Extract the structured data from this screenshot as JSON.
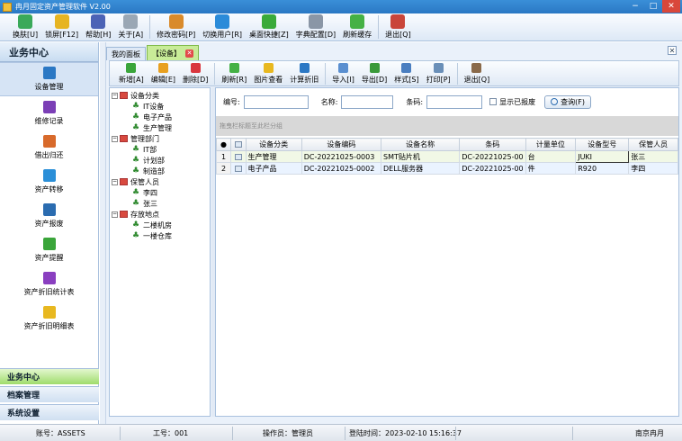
{
  "window": {
    "title": "冉月固定资产管理软件 V2.00"
  },
  "main_toolbar": [
    {
      "label": "换肤[U]",
      "icon": "shirt-icon",
      "color": "#3aa95a"
    },
    {
      "label": "锁屏[F12]",
      "icon": "lock-icon",
      "color": "#e6b422"
    },
    {
      "label": "帮助[H]",
      "icon": "help-icon",
      "color": "#4c63b6"
    },
    {
      "label": "关于[A]",
      "icon": "about-icon",
      "color": "#9aa7b5"
    },
    {
      "label": "修改密码[P]",
      "icon": "key-icon",
      "color": "#d98a2b"
    },
    {
      "label": "切换用户[R]",
      "icon": "switch-user-icon",
      "color": "#2b8bd9"
    },
    {
      "label": "桌面快捷[Z]",
      "icon": "desktop-shortcut-icon",
      "color": "#3aaa3a"
    },
    {
      "label": "字典配置[D]",
      "icon": "gear-icon",
      "color": "#8a96a6"
    },
    {
      "label": "刷新缓存",
      "icon": "refresh-icon",
      "color": "#45b145"
    },
    {
      "label": "退出[Q]",
      "icon": "exit-icon",
      "color": "#c9453a"
    }
  ],
  "sidebar": {
    "header": "业务中心",
    "items": [
      {
        "label": "设备管理",
        "icon": "monitor-icon",
        "color": "#2b78c4"
      },
      {
        "label": "维修记录",
        "icon": "wrench-icon",
        "color": "#7b3fb6"
      },
      {
        "label": "借出归还",
        "icon": "borrow-return-icon",
        "color": "#d86a2b"
      },
      {
        "label": "资产转移",
        "icon": "move-arrows-icon",
        "color": "#2b8fd8"
      },
      {
        "label": "资产报废",
        "icon": "scrap-icon",
        "color": "#2b6cb0"
      },
      {
        "label": "资产提醒",
        "icon": "reminder-icon",
        "color": "#3aa53a"
      },
      {
        "label": "资产折旧统计表",
        "icon": "stats-list-icon",
        "color": "#8a3fc0"
      },
      {
        "label": "资产折旧明细表",
        "icon": "detail-notebook-icon",
        "color": "#e8b820"
      }
    ],
    "groups": [
      "业务中心",
      "档案管理",
      "系统设置"
    ]
  },
  "tabs": [
    {
      "label": "我的面板"
    },
    {
      "label": "【设备】"
    }
  ],
  "toolbar": [
    {
      "label": "新增[A]",
      "icon": "add-icon",
      "color": "#3aa53a"
    },
    {
      "label": "编辑[E]",
      "icon": "edit-icon",
      "color": "#e8a020"
    },
    {
      "label": "删除[D]",
      "icon": "delete-icon",
      "color": "#d9363e"
    },
    {
      "label": "刷新[R]",
      "icon": "refresh-icon",
      "color": "#45b145"
    },
    {
      "label": "图片查看",
      "icon": "image-icon",
      "color": "#e8b820"
    },
    {
      "label": "计算折旧",
      "icon": "calculator-icon",
      "color": "#2b78c4"
    },
    {
      "label": "导入[I]",
      "icon": "import-icon",
      "color": "#5a8fd0"
    },
    {
      "label": "导出[D]",
      "icon": "export-icon",
      "color": "#3a9a3a"
    },
    {
      "label": "样式[S]",
      "icon": "style-icon",
      "color": "#4a7ec0"
    },
    {
      "label": "打印[P]",
      "icon": "printer-icon",
      "color": "#6a8fb8"
    },
    {
      "label": "退出[Q]",
      "icon": "exit-icon",
      "color": "#8a6a4a"
    }
  ],
  "tree": {
    "groups": [
      {
        "label": "设备分类",
        "children": [
          "IT设备",
          "电子产品",
          "生产管理"
        ]
      },
      {
        "label": "管理部门",
        "children": [
          "IT部",
          "计划部",
          "制造部"
        ]
      },
      {
        "label": "保管人员",
        "children": [
          "李四",
          "张三"
        ]
      },
      {
        "label": "存放地点",
        "children": [
          "二楼机房",
          "一楼仓库"
        ]
      }
    ]
  },
  "filter": {
    "code_label": "编号:",
    "name_label": "名称:",
    "barcode_label": "条码:",
    "code_value": "",
    "name_value": "",
    "barcode_value": "",
    "show_scrapped_label": "显示已报废",
    "query_label": "查询(F)"
  },
  "grid": {
    "group_hint": "拖曳栏标题至此栏分组",
    "columns": [
      "设备分类",
      "设备编码",
      "设备名称",
      "条码",
      "计量单位",
      "设备型号",
      "保管人员"
    ],
    "rows": [
      {
        "idx": "1",
        "cells": [
          "生产管理",
          "DC-20221025-0003",
          "SMT贴片机",
          "DC-20221025-00",
          "台",
          "JUKI",
          "张三"
        ]
      },
      {
        "idx": "2",
        "cells": [
          "电子产品",
          "DC-20221025-0002",
          "DELL服务器",
          "DC-20221025-00",
          "件",
          "R920",
          "李四"
        ]
      }
    ]
  },
  "status": {
    "account": "账号：ASSETS",
    "employee_no": "工号：001",
    "operator": "操作员：管理员",
    "login_time": "登陆时间：2023-02-10 15:16:37",
    "company": "南京冉月"
  }
}
